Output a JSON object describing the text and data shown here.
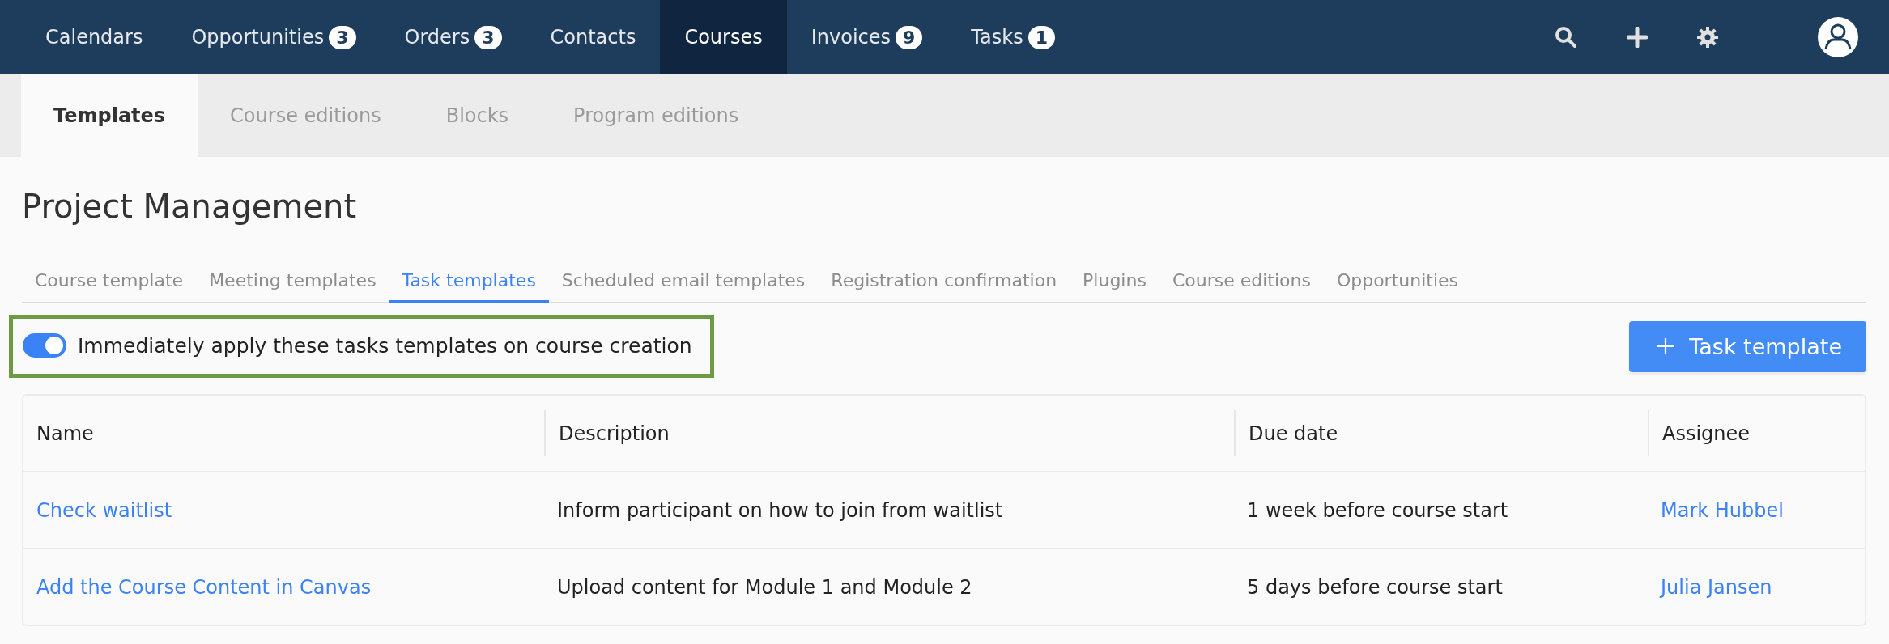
{
  "top_nav": {
    "items": [
      {
        "label": "Calendars",
        "selected": false
      },
      {
        "label": "Opportunities",
        "badge": "3",
        "selected": false
      },
      {
        "label": "Orders",
        "badge": "3",
        "selected": false
      },
      {
        "label": "Contacts",
        "selected": false
      },
      {
        "label": "Courses",
        "selected": true
      },
      {
        "label": "Invoices",
        "badge": "9",
        "selected": false
      },
      {
        "label": "Tasks",
        "badge": "1",
        "selected": false
      }
    ]
  },
  "sub_tabs": [
    {
      "label": "Templates",
      "selected": true
    },
    {
      "label": "Course editions",
      "selected": false
    },
    {
      "label": "Blocks",
      "selected": false
    },
    {
      "label": "Program editions",
      "selected": false
    }
  ],
  "page_title": "Project Management",
  "section_tabs": [
    {
      "label": "Course template",
      "selected": false
    },
    {
      "label": "Meeting templates",
      "selected": false
    },
    {
      "label": "Task templates",
      "selected": true
    },
    {
      "label": "Scheduled email templates",
      "selected": false
    },
    {
      "label": "Registration confirmation",
      "selected": false
    },
    {
      "label": "Plugins",
      "selected": false
    },
    {
      "label": "Course editions",
      "selected": false
    },
    {
      "label": "Opportunities",
      "selected": false
    }
  ],
  "auto_apply_toggle": {
    "label": "Immediately apply these tasks templates on course creation",
    "on": true,
    "highlighted": true
  },
  "add_button": {
    "label": "Task template"
  },
  "table": {
    "columns": [
      "Name",
      "Description",
      "Due date",
      "Assignee"
    ],
    "rows": [
      {
        "name": "Check waitlist",
        "description": "Inform participant on how to join from waitlist",
        "due_date": "1 week before course start",
        "assignee": "Mark Hubbel"
      },
      {
        "name": "Add the Course Content in Canvas",
        "description": "Upload content for Module 1 and Module 2",
        "due_date": "5 days before course start",
        "assignee": "Julia Jansen"
      }
    ]
  }
}
